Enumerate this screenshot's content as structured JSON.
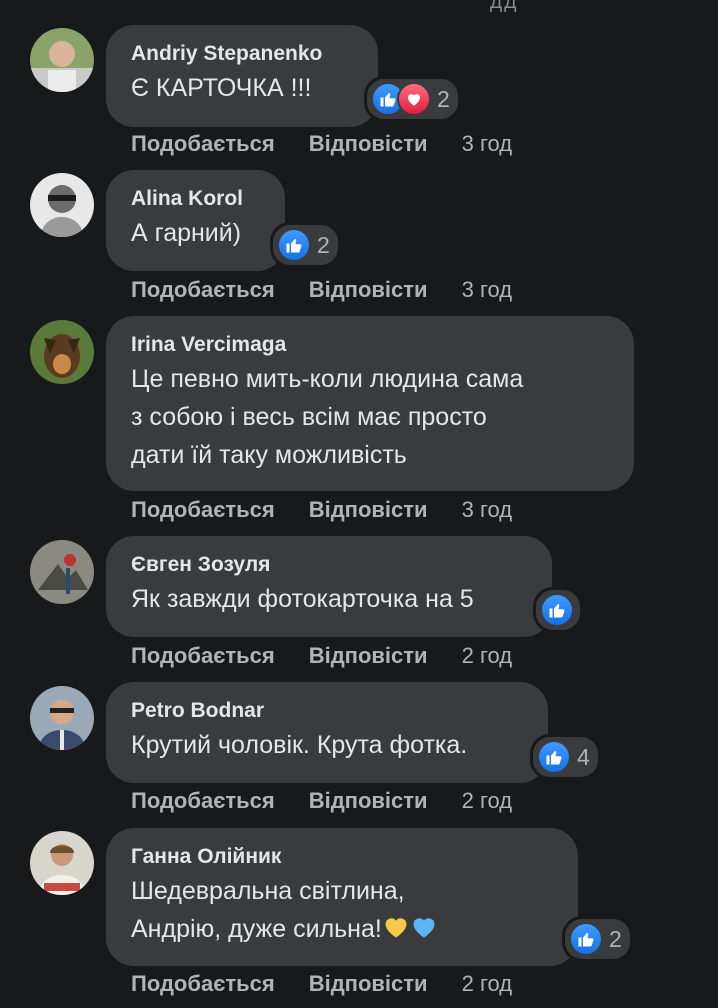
{
  "top_fragment": "ДД",
  "actions": {
    "like_label": "Подобається",
    "reply_label": "Відповісти"
  },
  "comments": [
    {
      "author": "Andriy Stepanenko",
      "text": "Є КАРТОЧКА !!!",
      "reactions": [
        "like-icon",
        "love-icon"
      ],
      "count": "2",
      "time": "3 год"
    },
    {
      "author": "Alina Korol",
      "text": "А гарний)",
      "reactions": [
        "like-icon"
      ],
      "count": "2",
      "time": "3 год"
    },
    {
      "author": "Irina Vercimaga",
      "text": "Це певно мить-коли людина сама\nз собою і весь всім має просто\nдати їй таку можливість",
      "reactions": [],
      "count": "",
      "time": "3 год"
    },
    {
      "author": "Євген Зозуля",
      "text": "Як завжди фотокарточка на 5",
      "reactions": [
        "like-icon"
      ],
      "count": "",
      "time": "2 год"
    },
    {
      "author": "Petro Bodnar",
      "text": "Крутий чоловік. Крута фотка.",
      "reactions": [
        "like-icon"
      ],
      "count": "4",
      "time": "2 год"
    },
    {
      "author": "Ганна Олійник",
      "text": "Шедевральна світлина,\nАндрію, дуже сильна!",
      "emojis": [
        "yellow-heart-icon",
        "blue-heart-icon"
      ],
      "reactions": [
        "like-icon"
      ],
      "count": "2",
      "time": "2 год"
    }
  ]
}
